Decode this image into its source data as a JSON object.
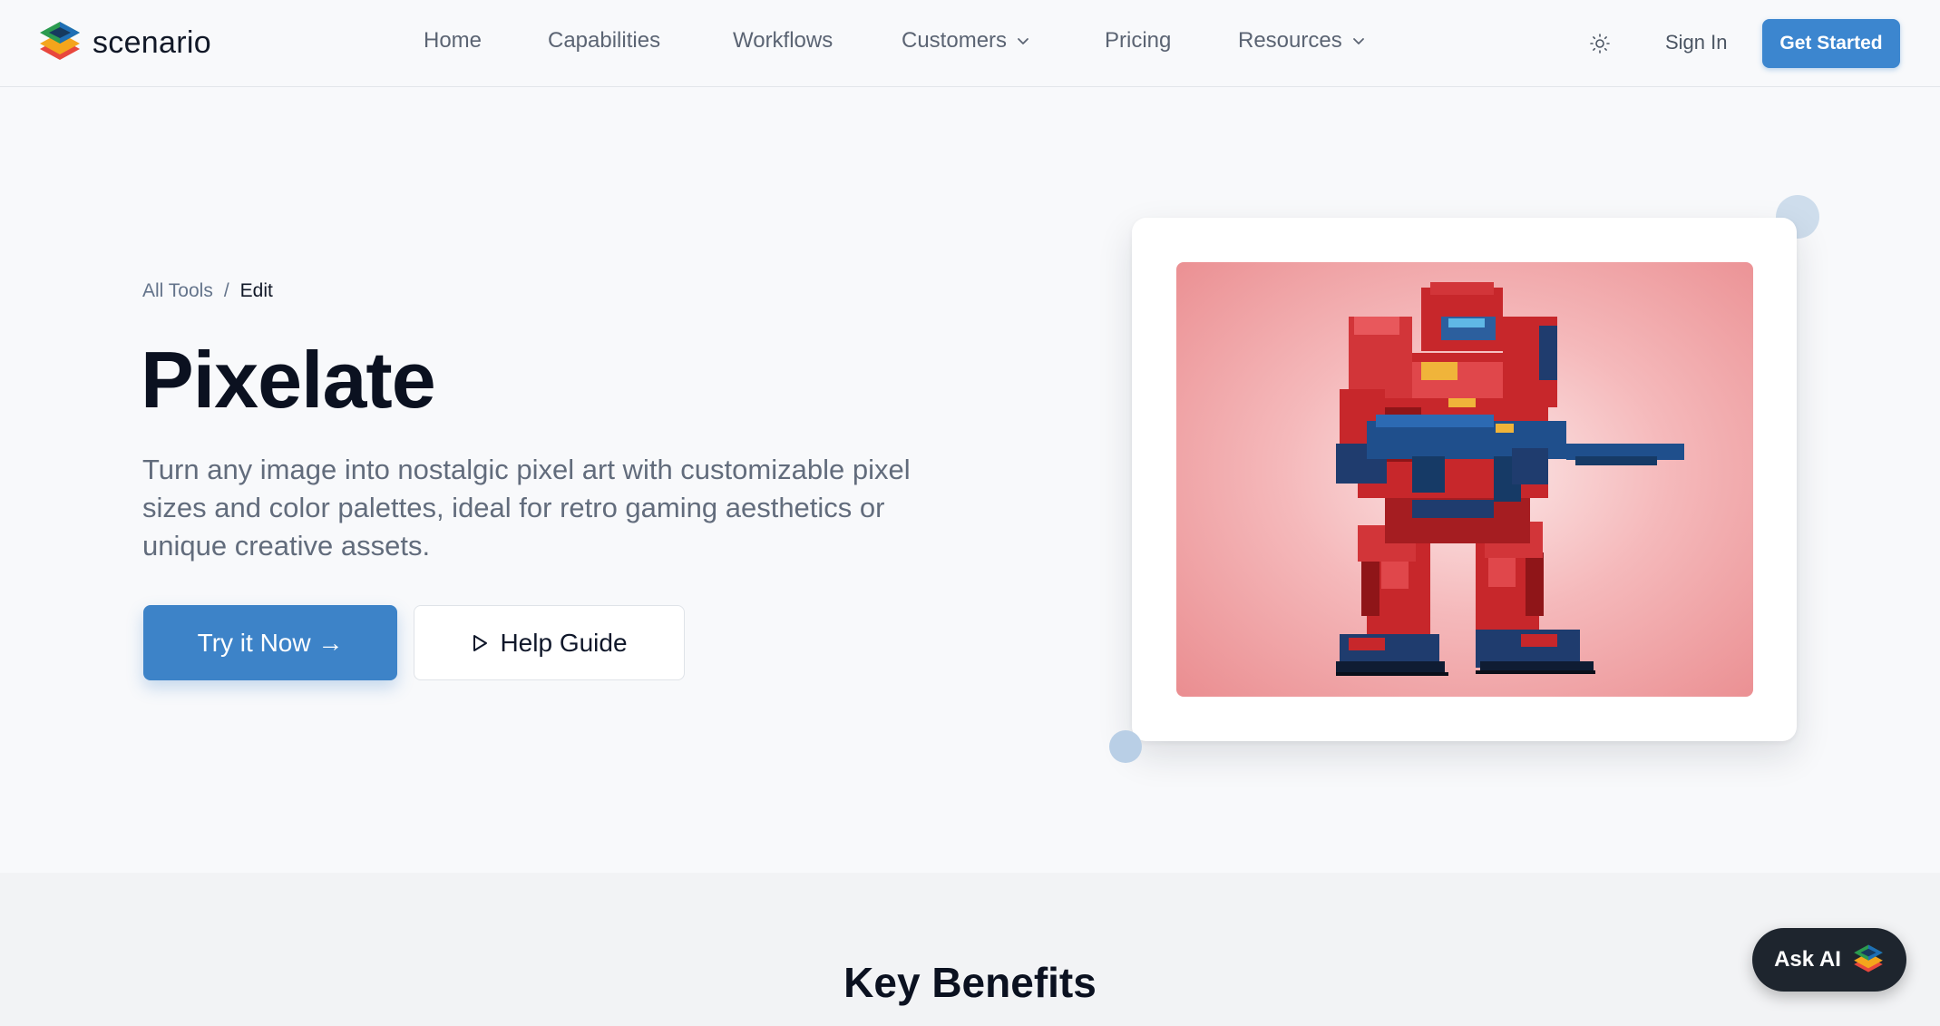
{
  "header": {
    "logo_text": "scenario",
    "nav": [
      {
        "label": "Home"
      },
      {
        "label": "Capabilities"
      },
      {
        "label": "Workflows"
      },
      {
        "label": "Customers",
        "dropdown": true
      },
      {
        "label": "Pricing"
      },
      {
        "label": "Resources",
        "dropdown": true
      }
    ],
    "theme_icon": "sun-icon",
    "sign_in": "Sign In",
    "get_started": "Get Started"
  },
  "hero": {
    "breadcrumb": {
      "parent": "All Tools",
      "separator": "/",
      "current": "Edit"
    },
    "title": "Pixelate",
    "description": "Turn any image into nostalgic pixel art with customizable pixel sizes and color palettes, ideal for retro gaming aesthetics or unique creative assets.",
    "primary_cta": "Try it Now →",
    "secondary_cta": "Help Guide",
    "secondary_icon": "play-icon",
    "preview_image": "pixel-art-red-armored-soldier-with-blue-rifle"
  },
  "section": {
    "title": "Key Benefits"
  },
  "chat": {
    "label": "Ask AI",
    "icon": "scenario-logo-icon"
  },
  "colors": {
    "accent": "#3c86cf",
    "page_bg": "#f8f9fb",
    "text_dark": "#0b1120",
    "text_muted": "#626c7c",
    "chat_bg": "#1e252e"
  }
}
